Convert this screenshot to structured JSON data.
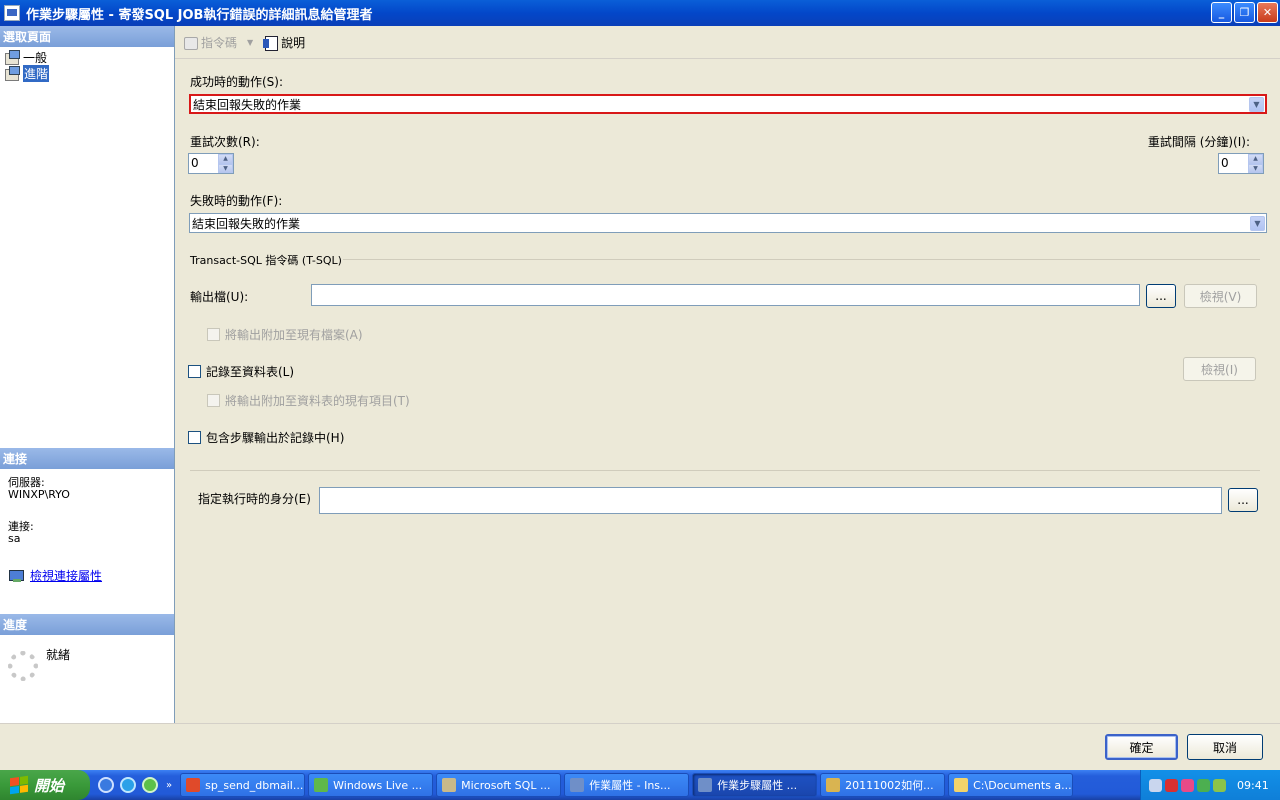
{
  "window": {
    "title": "作業步驟屬性 - 寄發SQL JOB執行錯誤的詳細訊息給管理者",
    "buttons": {
      "minimize": "_",
      "restore": "❐",
      "close": "✕"
    }
  },
  "left_pane": {
    "select_page_header": "選取頁面",
    "pages": [
      {
        "label": "一般",
        "selected": false
      },
      {
        "label": "進階",
        "selected": true
      }
    ],
    "connection_header": "連接",
    "server_label": "伺服器:",
    "server_value": "WINXP\\RYO",
    "connection_label": "連接:",
    "connection_value": "sa",
    "view_connection_link": "檢視連接屬性",
    "progress_header": "進度",
    "progress_status": "就緒"
  },
  "toolbar": {
    "script_label": "指令碼",
    "help_label": "說明"
  },
  "form": {
    "on_success_label": "成功時的動作(S):",
    "on_success_value": "結束回報失敗的作業",
    "retry_attempts_label": "重試次數(R):",
    "retry_attempts_value": "0",
    "retry_interval_label": "重試間隔 (分鐘)(I):",
    "retry_interval_value": "0",
    "on_failure_label": "失敗時的動作(F):",
    "on_failure_value": "結束回報失敗的作業",
    "tsql_group_label": "Transact-SQL 指令碼 (T-SQL)",
    "output_file_label": "輸出檔(U):",
    "output_file_value": "",
    "browse_button": "...",
    "view_button_1": "檢視(V)",
    "append_output_file_label": "將輸出附加至現有檔案(A)",
    "log_to_table_label": "記錄至資料表(L)",
    "view_button_2": "檢視(I)",
    "append_output_table_label": "將輸出附加至資料表的現有項目(T)",
    "include_step_output_label": "包含步驟輸出於記錄中(H)",
    "run_as_label": "指定執行時的身分(E)",
    "run_as_value": "",
    "run_as_browse": "..."
  },
  "dialog_buttons": {
    "ok": "確定",
    "cancel": "取消"
  },
  "taskbar": {
    "start_label": "開始",
    "tasks": [
      {
        "label": "sp_send_dbmail...",
        "active": false,
        "icon_color": "#e04a2a"
      },
      {
        "label": "Windows Live ...",
        "active": false,
        "icon_color": "#5fb84a"
      },
      {
        "label": "Microsoft SQL ...",
        "active": false,
        "icon_color": "#c9b98a"
      },
      {
        "label": "作業屬性 - Ins...",
        "active": false,
        "icon_color": "#6f8fc8"
      },
      {
        "label": "作業步驟屬性 ...",
        "active": true,
        "icon_color": "#6f8fc8"
      },
      {
        "label": "20111002如何...",
        "active": false,
        "icon_color": "#d9b451"
      },
      {
        "label": "C:\\Documents a...",
        "active": false,
        "icon_color": "#f3d36b"
      }
    ],
    "clock": "09:41"
  },
  "colors": {
    "titlebar": "#0a5fd8",
    "highlight_border": "#d81818",
    "selection": "#316ac5",
    "section_header": "#7a9fd8",
    "dialog_bg": "#ece9d8"
  }
}
